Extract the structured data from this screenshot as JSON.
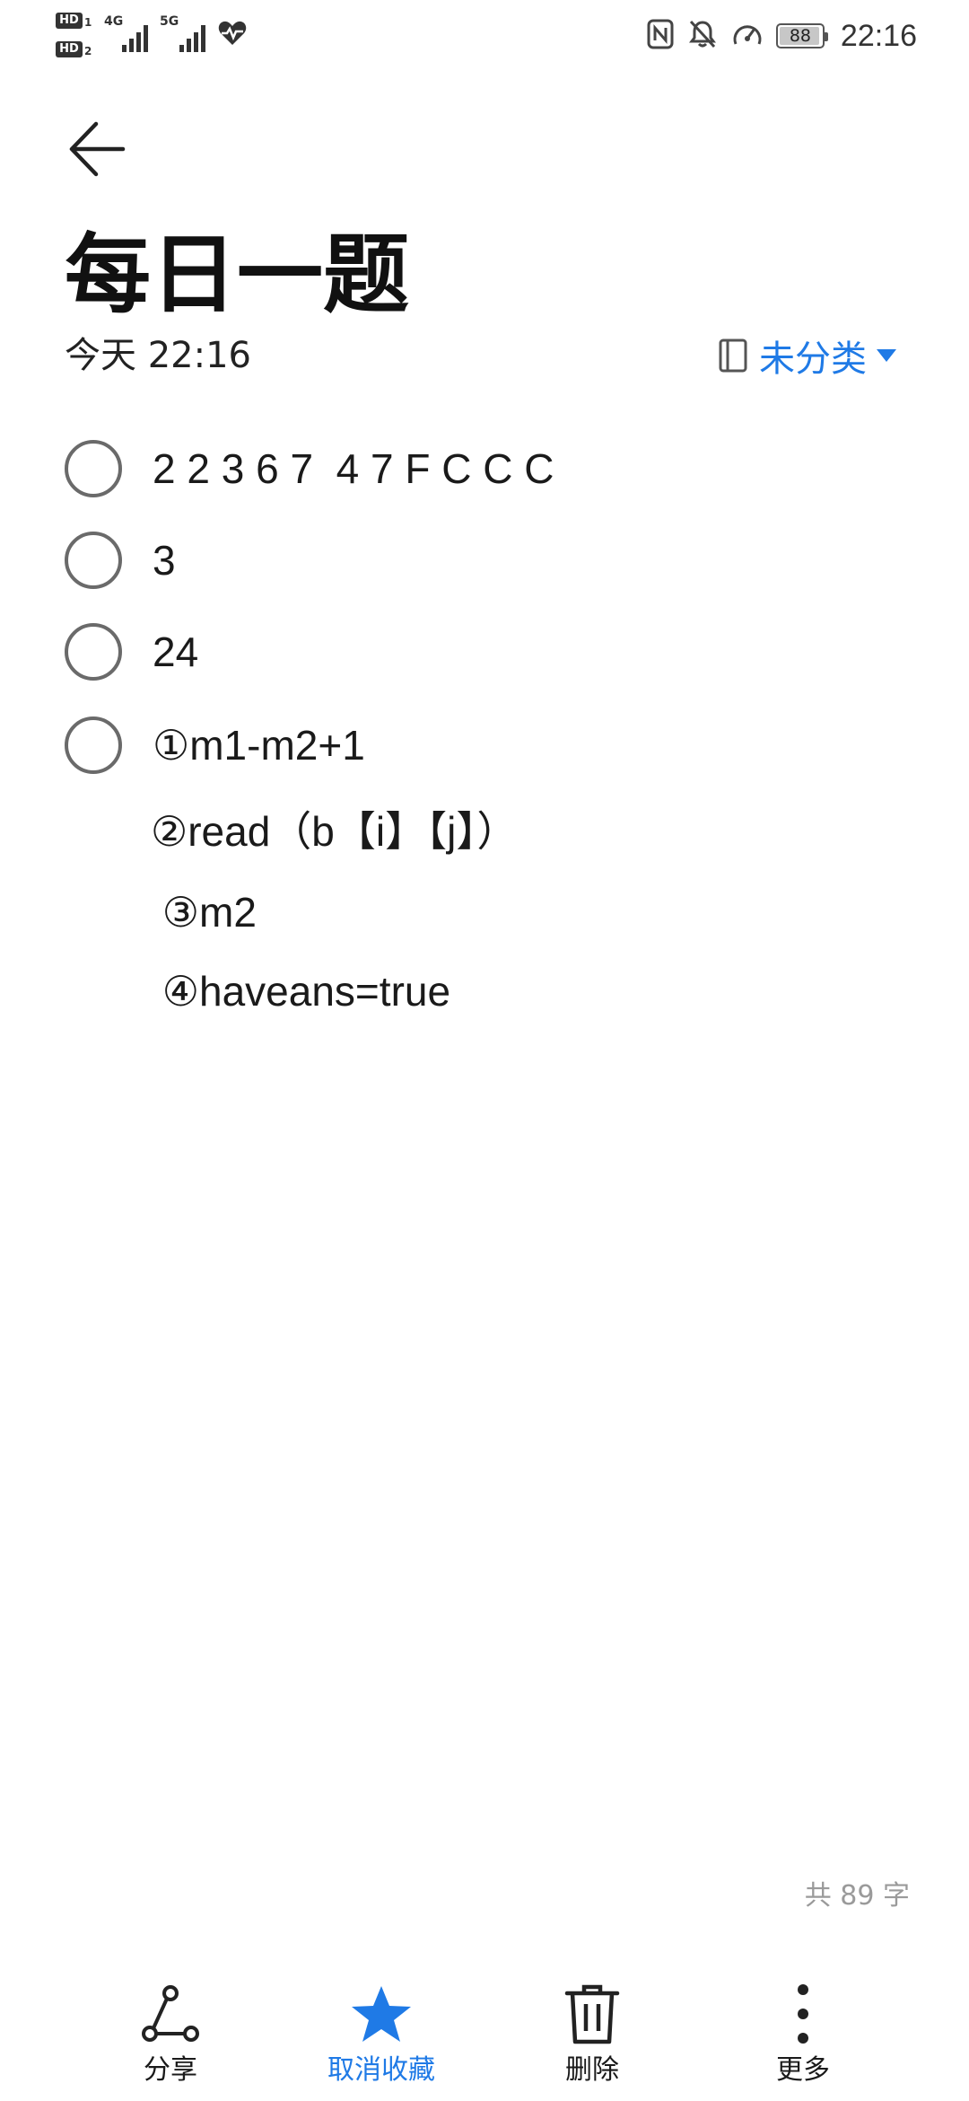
{
  "status_bar": {
    "sim1_badge": "HD",
    "sim1_index": "1",
    "sim2_badge": "HD",
    "sim2_index": "2",
    "net1_label": "4G",
    "net2_label": "5G",
    "battery_level": "88",
    "time": "22:16",
    "icons": [
      "nfc-icon",
      "mute-bell-icon",
      "speed-icon",
      "heart-pulse-icon"
    ]
  },
  "header": {
    "back_icon": "arrow-left-icon",
    "title": "每日一题",
    "date": "今天 22:16",
    "category": "未分类",
    "category_icon": "notebook-icon",
    "dropdown_icon": "triangle-down-icon"
  },
  "checklist": {
    "items": [
      {
        "text": "2 2 3 6 7  4 7 F C C C",
        "checked": false
      },
      {
        "text": "3",
        "checked": false
      },
      {
        "text": "24",
        "checked": false
      },
      {
        "text": "①m1-m2+1",
        "checked": false
      }
    ],
    "continuation_lines": [
      "②read（b【i】【j】）",
      " ③m2",
      " ④haveans=true"
    ]
  },
  "footer": {
    "word_count": "共 89 字"
  },
  "toolbar": {
    "share_label": "分享",
    "unfavorite_label": "取消收藏",
    "delete_label": "删除",
    "more_label": "更多"
  },
  "colors": {
    "accent": "#1f7ae6",
    "text": "#1a1a1a",
    "muted": "#9a9a9a",
    "checkbox_border": "#6a6a6a"
  }
}
